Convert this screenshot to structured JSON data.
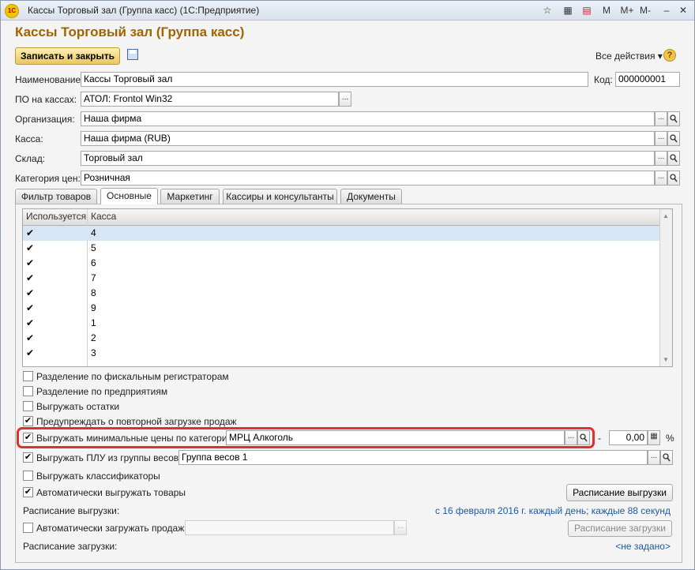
{
  "window": {
    "title": "Кассы Торговый зал (Группа касс)  (1С:Предприятие)",
    "icon_label": "1С",
    "toolbar": [
      "M",
      "M+",
      "M-"
    ]
  },
  "form": {
    "heading": "Кассы Торговый зал (Группа касс)",
    "save_close": "Записать и закрыть",
    "all_actions": "Все действия ▾",
    "help": "?"
  },
  "fields": {
    "name_label": "Наименование:",
    "name_value": "Кассы Торговый зал",
    "code_label": "Код:",
    "code_value": "000000001",
    "software_label": "ПО на кассах:",
    "software_value": "АТОЛ: Frontol Win32",
    "org_label": "Организация:",
    "org_value": "Наша фирма",
    "cash_label": "Касса:",
    "cash_value": "Наша фирма (RUB)",
    "store_label": "Склад:",
    "store_value": "Торговый зал",
    "price_label": "Категория цен:",
    "price_value": "Розничная"
  },
  "tabs": [
    "Фильтр товаров",
    "Основные",
    "Маркетинг",
    "Кассиры и консультанты",
    "Документы"
  ],
  "table": {
    "col_used": "Используется",
    "col_cash": "Касса",
    "rows": [
      "4",
      "5",
      "6",
      "7",
      "8",
      "9",
      "1",
      "2",
      "3"
    ]
  },
  "options": {
    "split_fiscal": "Разделение по фискальным регистраторам",
    "split_enterprise": "Разделение по предприятиям",
    "export_balances": "Выгружать остатки",
    "warn_reload": "Предупреждать о повторной загрузке продаж",
    "export_min_prices": "Выгружать минимальные цены по категории:",
    "min_price_category": "МРЦ Алкоголь",
    "dash": "-",
    "percent_value": "0,00",
    "percent_sign": "%",
    "export_plu": "Выгружать ПЛУ из группы весов:",
    "plu_group": "Группа весов 1",
    "export_classifiers": "Выгружать классификаторы",
    "auto_export": "Автоматически выгружать товары",
    "export_schedule_btn": "Расписание выгрузки",
    "export_schedule_label": "Расписание выгрузки:",
    "export_schedule_value": "с 16 февраля 2016 г. каждый день; каждые 88 секунд",
    "auto_import": "Автоматически загружать продажи",
    "import_schedule_btn": "Расписание загрузки",
    "import_schedule_label": "Расписание загрузки:",
    "import_schedule_value": "<не задано>"
  }
}
